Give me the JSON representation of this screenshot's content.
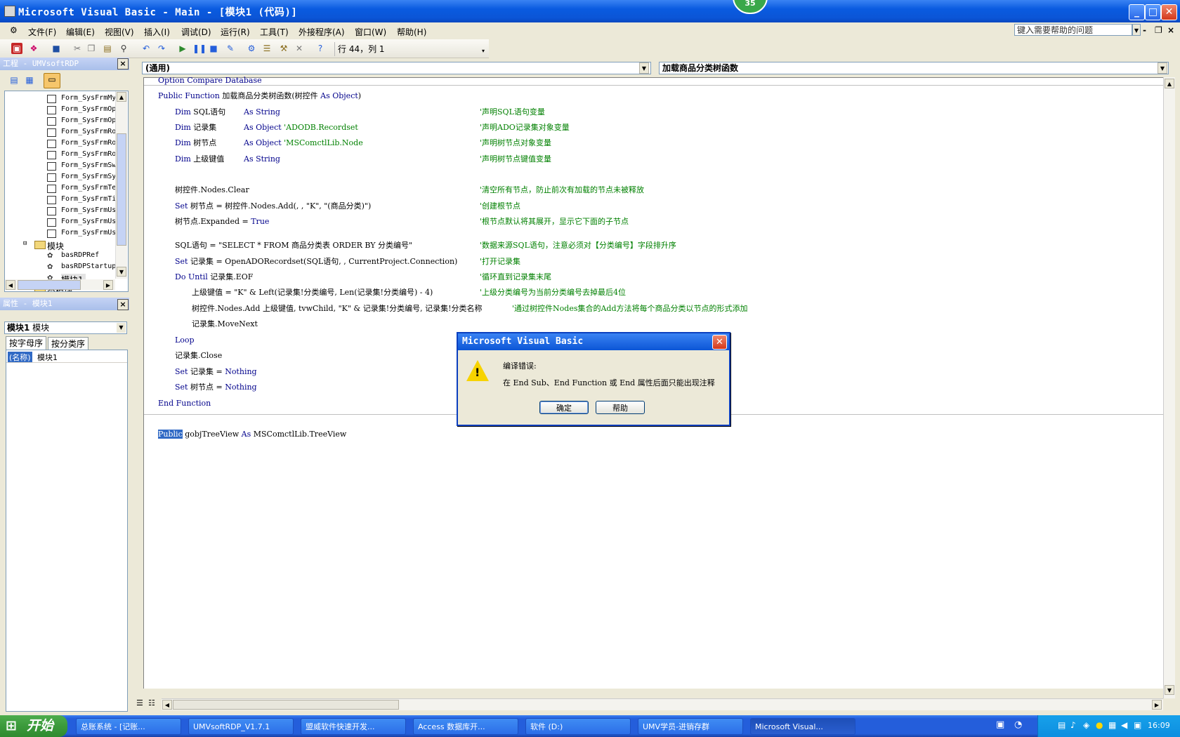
{
  "window": {
    "title": "Microsoft Visual Basic - Main - [模块1 (代码)]",
    "badge": "35",
    "min": "_",
    "max": "□",
    "close": "✕"
  },
  "menu": {
    "items": [
      "文件(F)",
      "编辑(E)",
      "视图(V)",
      "插入(I)",
      "调试(D)",
      "运行(R)",
      "工具(T)",
      "外接程序(A)",
      "窗口(W)",
      "帮助(H)"
    ],
    "help_search": "键入需要帮助的问题",
    "mdi_min": "-",
    "mdi_restore": "❐",
    "mdi_close": "×"
  },
  "toolbar": {
    "position": "行 44，列 1"
  },
  "project": {
    "title": "工程 - UMVsoftRDP",
    "close": "×",
    "items": [
      "Form_SysFrmMy",
      "Form_SysFrmOp",
      "Form_SysFrmOp",
      "Form_SysFrmRo",
      "Form_SysFrmRo",
      "Form_SysFrmRo",
      "Form_SysFrmSw",
      "Form_SysFrmSy",
      "Form_SysFrmTe",
      "Form_SysFrmTi",
      "Form_SysFrmUs",
      "Form_SysFrmUs",
      "Form_SysFrmUs"
    ],
    "folder_modules": "模块",
    "modules": [
      "basRDPRef",
      "basRDPStartup",
      "模块1"
    ],
    "folder_classes": "类模块"
  },
  "properties": {
    "title": "属性 - 模块1",
    "close": "×",
    "combo_bold": "模块1",
    "combo_rest": " 模块",
    "tab_alpha": "按字母序",
    "tab_cat": "按分类序",
    "row_name": "(名称)",
    "row_value": "模块1"
  },
  "code": {
    "object_combo": "(通用)",
    "proc_combo": "加载商品分类树函数",
    "l1_kw": "Option Compare Database",
    "l2_kw1": "Public Function",
    "l2_t1": " 加载商品分类树函数(树控件 ",
    "l2_kw2": "As Object",
    "l2_t2": ")",
    "l3_kw1": "Dim",
    "l3_t1": " SQL语句",
    "l3_kw2": "As String",
    "l3_cm": "'声明SQL语句变量",
    "l4_kw1": "Dim",
    "l4_t1": " 记录集",
    "l4_kw2": "As Object",
    "l4_cm1": " 'ADODB.Recordset",
    "l4_cm": "'声明ADO记录集对象变量",
    "l5_kw1": "Dim",
    "l5_t1": " 树节点",
    "l5_kw2": "As Object",
    "l5_cm1": " 'MSComctlLib.Node",
    "l5_cm": "'声明树节点对象变量",
    "l6_kw1": "Dim",
    "l6_t1": " 上级键值",
    "l6_kw2": "As String",
    "l6_cm": "'声明树节点键值变量",
    "l7_t": "树控件.Nodes.Clear",
    "l7_cm": "'清空所有节点，防止前次有加载的节点未被释放",
    "l8_kw": "Set",
    "l8_t": " 树节点 = 树控件.Nodes.Add(, , \"K\", \"(商品分类)\")",
    "l8_cm": "'创建根节点",
    "l9_t": "树节点.Expanded = ",
    "l9_kw": "True",
    "l9_cm": "'根节点默认将其展开，显示它下面的子节点",
    "l10_t": "SQL语句 = \"SELECT * FROM 商品分类表 ORDER BY 分类编号\"",
    "l10_cm": "'数据来源SQL语句，注意必须对【分类编号】字段排升序",
    "l11_kw": "Set",
    "l11_t": " 记录集 = OpenADORecordset(SQL语句, , CurrentProject.Connection)",
    "l11_cm": "'打开记录集",
    "l12_kw": "Do Until",
    "l12_t": " 记录集.EOF",
    "l12_cm": "'循环直到记录集末尾",
    "l13_t": "上级键值 = \"K\" & Left(记录集!分类编号, Len(记录集!分类编号) - 4)",
    "l13_cm": "'上级分类编号为当前分类编号去掉最后4位",
    "l14_t": "树控件.Nodes.Add 上级键值, tvwChild, \"K\" & 记录集!分类编号, 记录集!分类名称",
    "l14_cm": "'通过树控件Nodes集合的Add方法将每个商品分类以节点的形式添加",
    "l15_t": "记录集.MoveNext",
    "l16_kw": "Loop",
    "l17_t": "记录集.Close",
    "l18_kw1": "Set",
    "l18_t": " 记录集 = ",
    "l18_kw2": "Nothing",
    "l19_kw1": "Set",
    "l19_t": " 树节点 = ",
    "l19_kw2": "Nothing",
    "l20_kw": "End Function",
    "l21_sel": "Public",
    "l21_t1": " gobjTreeView ",
    "l21_kw": "As",
    "l21_t2": " MSComctlLib.TreeView"
  },
  "dialog": {
    "title": "Microsoft Visual Basic",
    "close": "✕",
    "heading": "编译错误:",
    "message": "在 End Sub、End Function 或 End 属性后面只能出现注释",
    "ok": "确定",
    "help": "帮助"
  },
  "taskbar": {
    "start": "开始",
    "buttons": [
      "总账系统 - [记账...",
      "UMVsoftRDP_V1.7.1",
      "盟威软件快速开发...",
      "Access 数据库开...",
      "软件 (D:)",
      "UMV学员-进销存群",
      "Microsoft Visual..."
    ],
    "clock": "16:09"
  },
  "colors": {
    "keyword": "#00008b",
    "comment": "#008000",
    "titlebar": "#0b55d6",
    "selection": "#316ac5"
  }
}
